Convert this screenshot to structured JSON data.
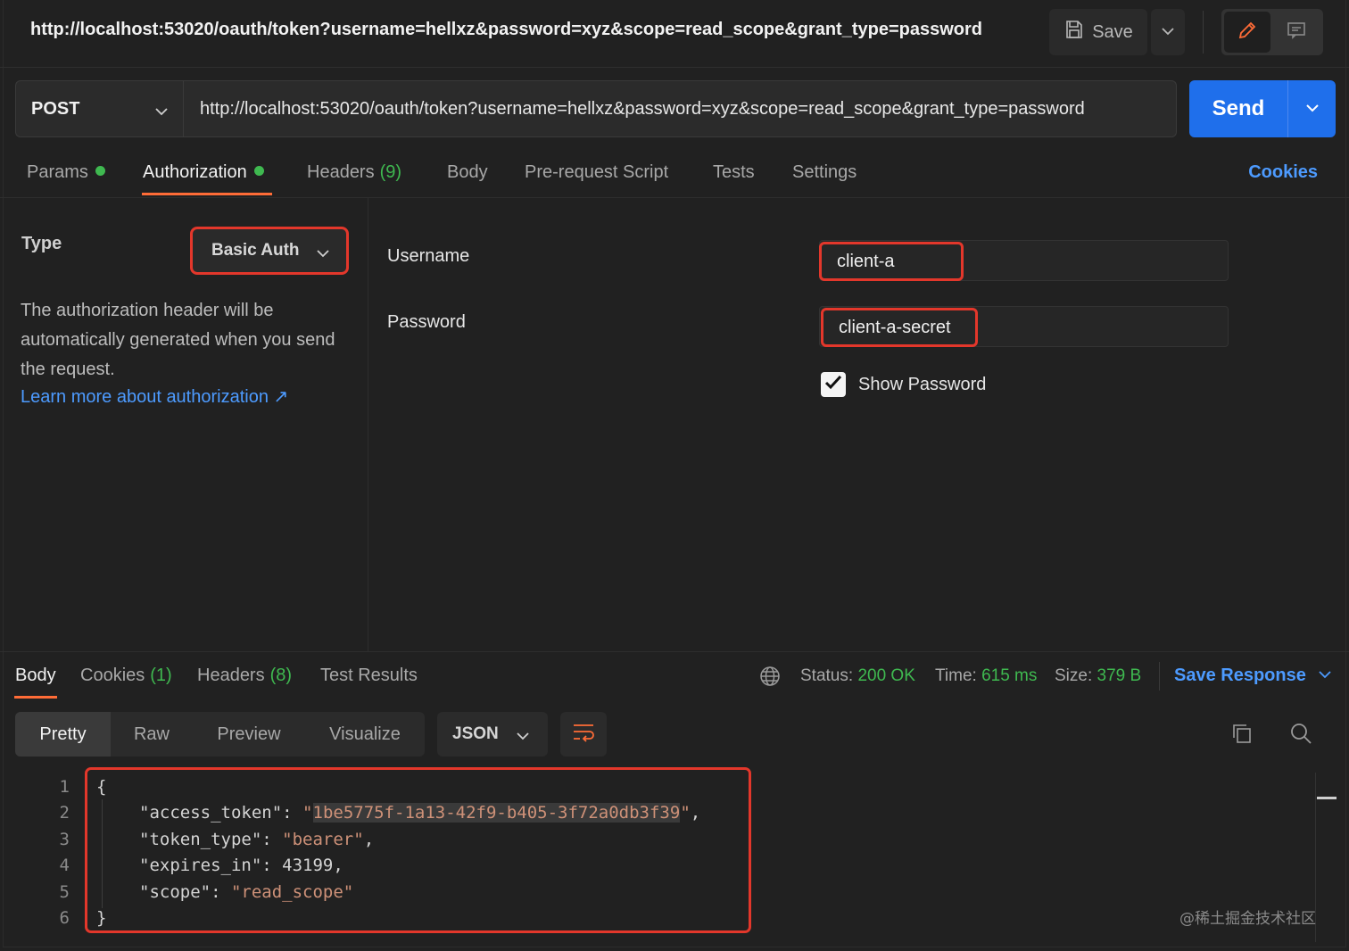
{
  "title_bar": {
    "title": "http://localhost:53020/oauth/token?username=hellxz&password=xyz&scope=read_scope&grant_type=password",
    "save_label": "Save"
  },
  "request": {
    "method": "POST",
    "url": "http://localhost:53020/oauth/token?username=hellxz&password=xyz&scope=read_scope&grant_type=password",
    "send_label": "Send"
  },
  "request_tabs": {
    "params": "Params",
    "authorization": "Authorization",
    "headers": "Headers",
    "headers_count": "(9)",
    "body": "Body",
    "pre_request": "Pre-request Script",
    "tests": "Tests",
    "settings": "Settings",
    "cookies": "Cookies"
  },
  "auth": {
    "type_label": "Type",
    "type_value": "Basic Auth",
    "description": "The authorization header will be automatically generated when you send the request.",
    "learn_more": "Learn more about authorization ↗",
    "username_label": "Username",
    "username_value": "client-a",
    "password_label": "Password",
    "password_value": "client-a-secret",
    "show_password_label": "Show Password",
    "show_password_checked": true
  },
  "response_tabs": {
    "body": "Body",
    "cookies": "Cookies",
    "cookies_count": "(1)",
    "headers": "Headers",
    "headers_count": "(8)",
    "test_results": "Test Results"
  },
  "response_status": {
    "status_label": "Status:",
    "status_value": "200 OK",
    "time_label": "Time:",
    "time_value": "615 ms",
    "size_label": "Size:",
    "size_value": "379 B",
    "save_response": "Save Response"
  },
  "response_view": {
    "modes": [
      "Pretty",
      "Raw",
      "Preview",
      "Visualize"
    ],
    "active_mode": "Pretty",
    "format": "JSON"
  },
  "response_body": {
    "line_numbers": [
      "1",
      "2",
      "3",
      "4",
      "5",
      "6"
    ],
    "open_brace": "{",
    "close_brace": "}",
    "access_token_key": "\"access_token\"",
    "access_token_value": "1be5775f-1a13-42f9-b405-3f72a0db3f39",
    "token_type_key": "\"token_type\"",
    "token_type_value": "\"bearer\"",
    "expires_in_key": "\"expires_in\"",
    "expires_in_value": "43199",
    "scope_key": "\"scope\"",
    "scope_value": "\"read_scope\""
  },
  "watermark": "@稀土掘金技术社区",
  "icons": {
    "save": "floppy-disk-icon",
    "edit": "pencil-icon",
    "comment": "comment-icon",
    "globe": "globe-icon",
    "copy": "copy-icon",
    "search": "search-icon",
    "wrap": "wrap-lines-icon"
  },
  "colors": {
    "accent_orange": "#ff6c37",
    "send_blue": "#1f6feb",
    "link_blue": "#4d9bff",
    "success_green": "#3fb950",
    "highlight_red": "#e3372b"
  }
}
